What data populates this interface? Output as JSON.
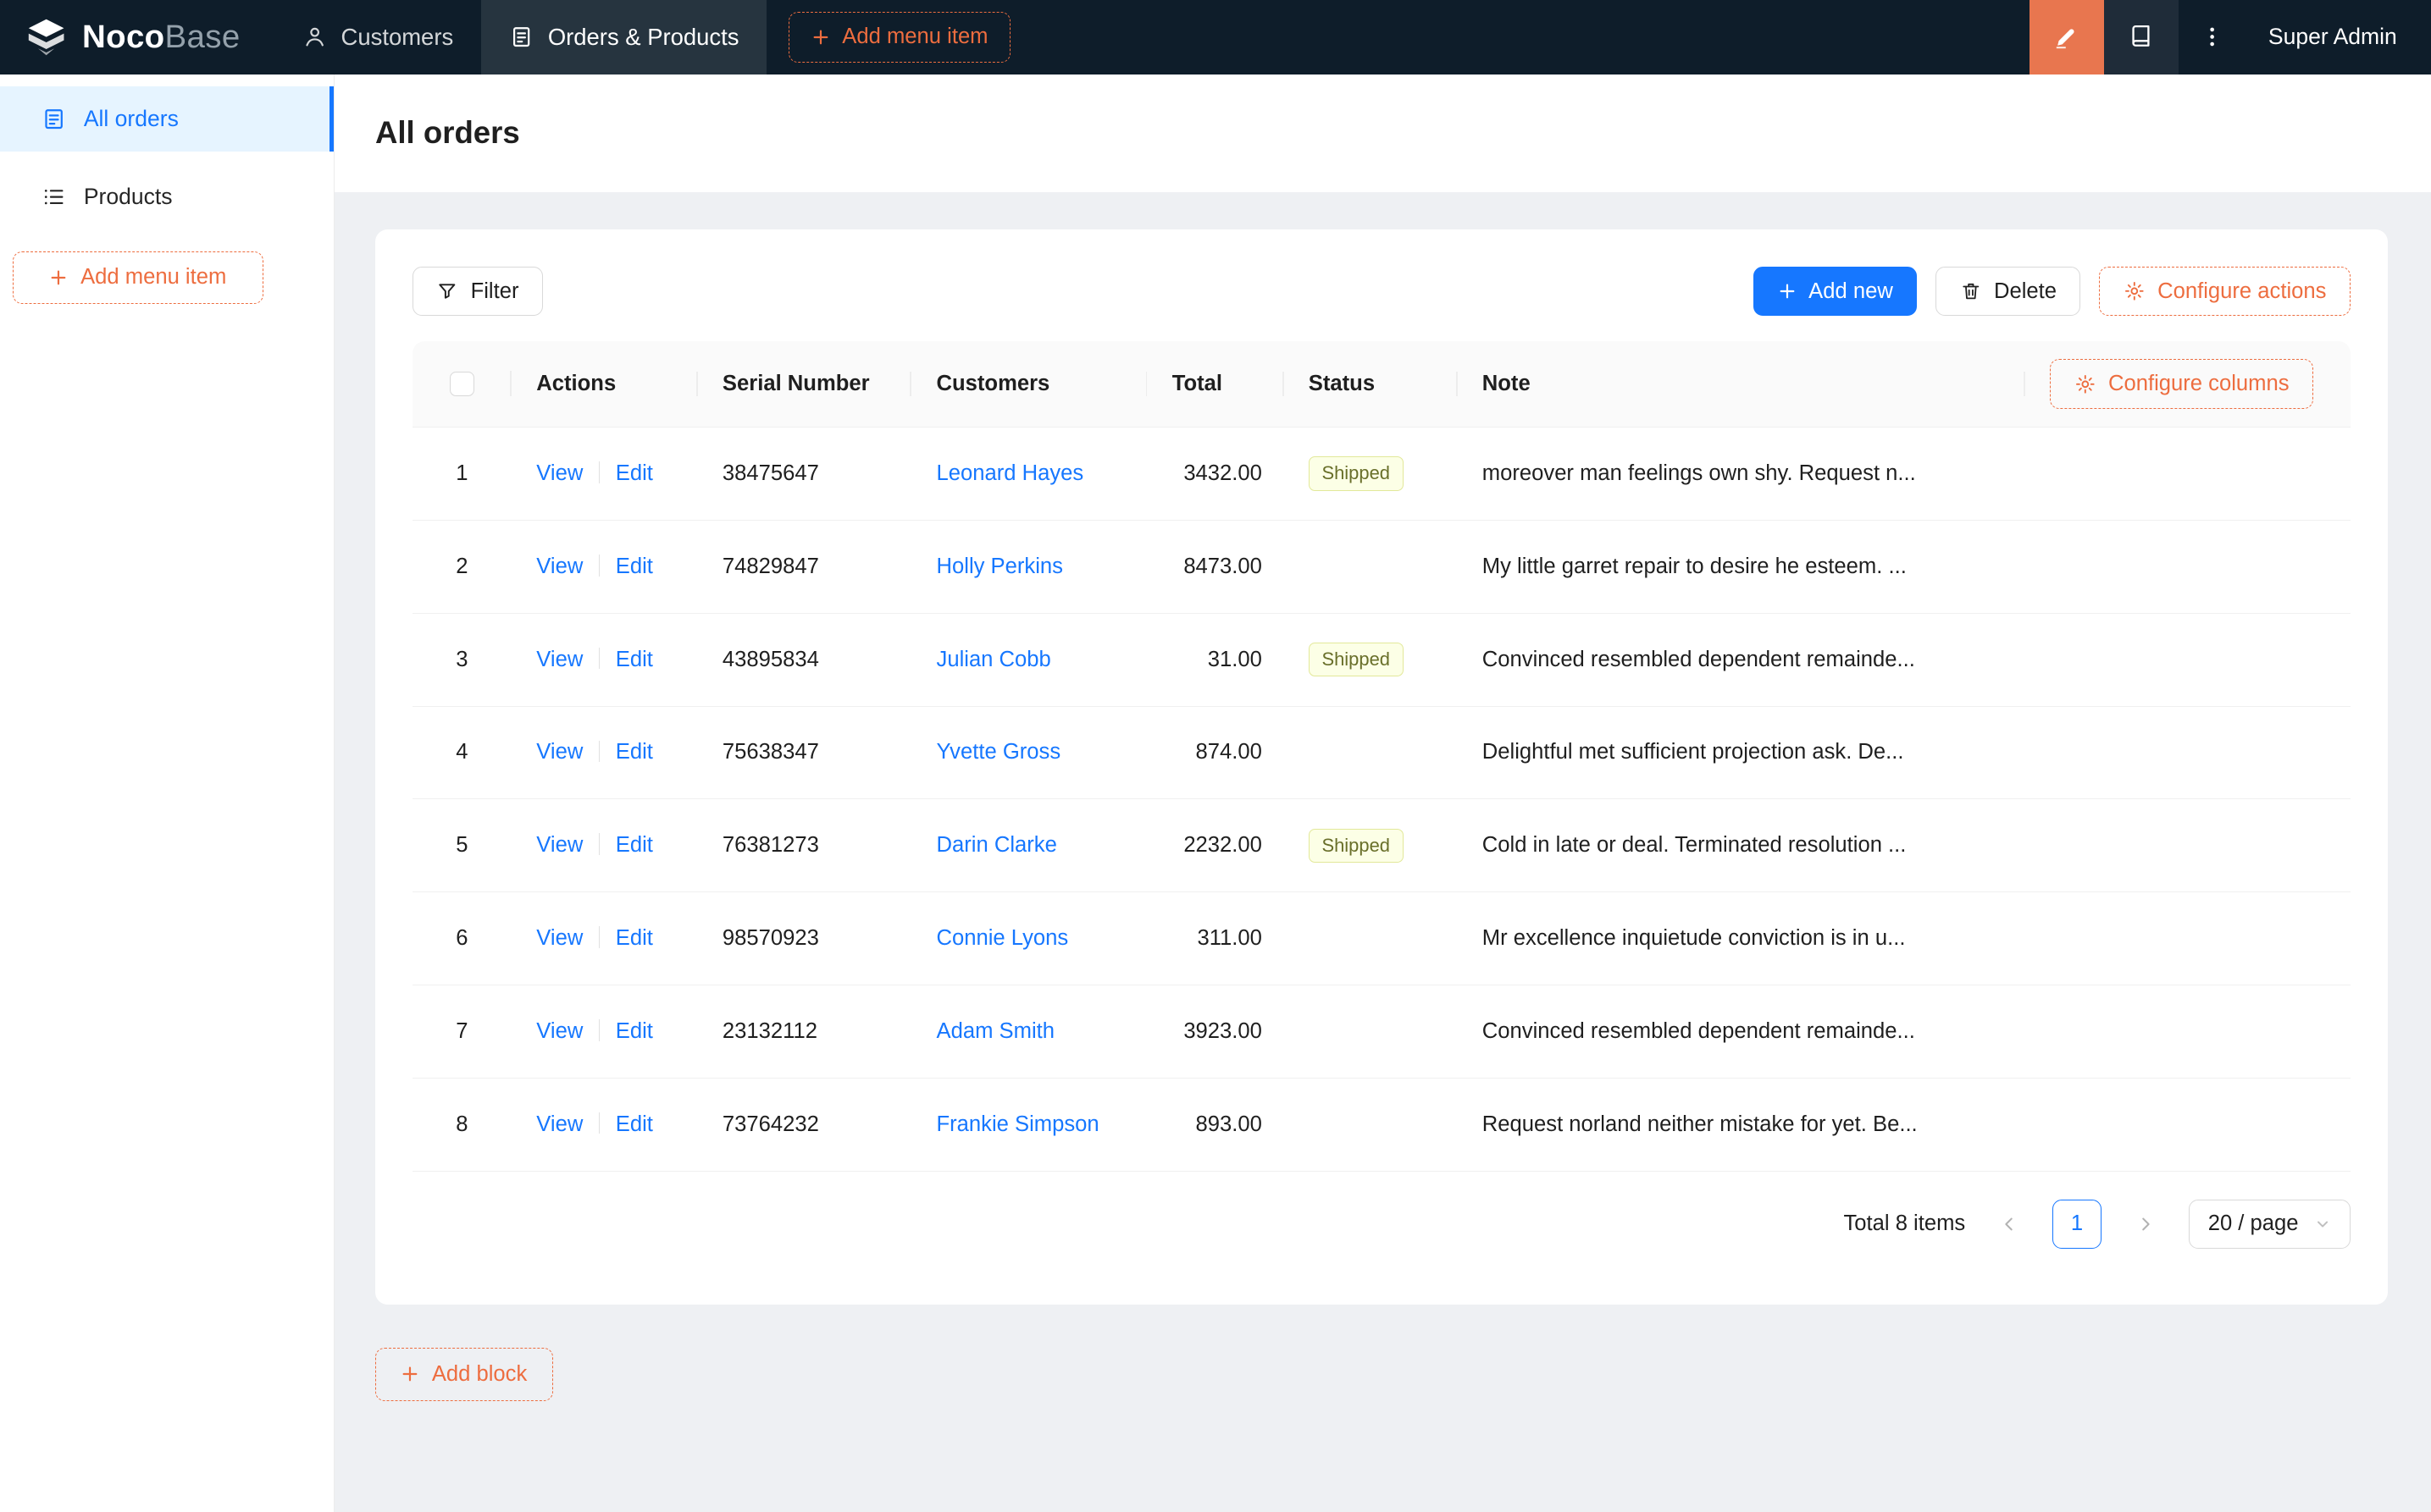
{
  "header": {
    "brand": {
      "bold": "Noco",
      "light": "Base"
    },
    "tabs": [
      {
        "label": "Customers",
        "icon": "customers-icon",
        "active": false
      },
      {
        "label": "Orders & Products",
        "icon": "orders-icon",
        "active": true
      }
    ],
    "add_menu_item_label": "Add menu item",
    "user_name": "Super Admin",
    "icons": [
      "highlighter-icon",
      "book-icon",
      "ellipsis-vertical-icon"
    ]
  },
  "sidebar": {
    "items": [
      {
        "label": "All orders",
        "icon": "form-icon",
        "active": true
      },
      {
        "label": "Products",
        "icon": "list-icon",
        "active": false
      }
    ],
    "add_menu_item_label": "Add menu item"
  },
  "page": {
    "title": "All orders"
  },
  "toolbar": {
    "filter_label": "Filter",
    "add_new_label": "Add new",
    "delete_label": "Delete",
    "configure_actions_label": "Configure actions"
  },
  "table": {
    "configure_columns_label": "Configure columns",
    "columns": [
      "Actions",
      "Serial Number",
      "Customers",
      "Total",
      "Status",
      "Note"
    ],
    "action_labels": {
      "view": "View",
      "edit": "Edit"
    },
    "rows": [
      {
        "index": "1",
        "serial": "38475647",
        "customer": "Leonard Hayes",
        "total": "3432.00",
        "status": "Shipped",
        "note": "moreover man feelings own shy. Request n..."
      },
      {
        "index": "2",
        "serial": "74829847",
        "customer": "Holly Perkins",
        "total": "8473.00",
        "status": "",
        "note": "My little garret repair to desire he esteem. ..."
      },
      {
        "index": "3",
        "serial": "43895834",
        "customer": "Julian Cobb",
        "total": "31.00",
        "status": "Shipped",
        "note": "Convinced resembled dependent remainde..."
      },
      {
        "index": "4",
        "serial": "75638347",
        "customer": "Yvette Gross",
        "total": "874.00",
        "status": "",
        "note": "Delightful met sufficient projection ask. De..."
      },
      {
        "index": "5",
        "serial": "76381273",
        "customer": "Darin Clarke",
        "total": "2232.00",
        "status": "Shipped",
        "note": "Cold in late or deal. Terminated resolution ..."
      },
      {
        "index": "6",
        "serial": "98570923",
        "customer": "Connie Lyons",
        "total": "311.00",
        "status": "",
        "note": "Mr excellence inquietude conviction is in u..."
      },
      {
        "index": "7",
        "serial": "23132112",
        "customer": "Adam Smith",
        "total": "3923.00",
        "status": "",
        "note": "Convinced resembled dependent remainde..."
      },
      {
        "index": "8",
        "serial": "73764232",
        "customer": "Frankie Simpson",
        "total": "893.00",
        "status": "",
        "note": "Request norland neither mistake for yet. Be..."
      }
    ]
  },
  "pagination": {
    "total_label": "Total 8 items",
    "current_page": "1",
    "page_size_label": "20 / page"
  },
  "footer": {
    "add_block_label": "Add block"
  },
  "colors": {
    "accent_orange": "#ed6d3f",
    "designer_button_bg": "#e8764f",
    "primary_blue": "#1677ff",
    "header_bg": "#0e1d2a",
    "sidebar_active_bg": "#e6f4ff",
    "status_tag": {
      "bg": "#fcffe6",
      "border": "#e2e89a",
      "text": "#696f2a"
    }
  }
}
